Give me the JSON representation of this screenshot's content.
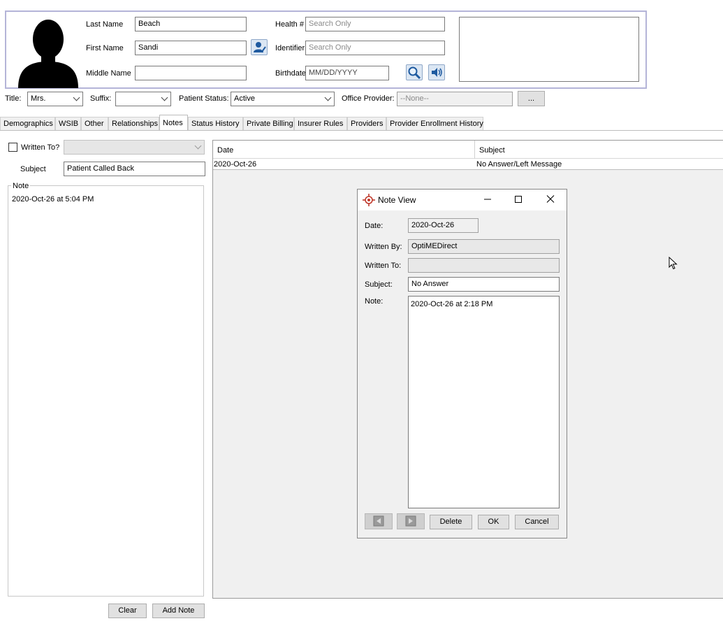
{
  "patient": {
    "last_name_label": "Last Name",
    "last_name": "Beach",
    "first_name_label": "First Name",
    "first_name": "Sandi",
    "middle_name_label": "Middle Name",
    "middle_name": "",
    "health_label": "Health #",
    "health_placeholder": "Search Only",
    "identifier_label": "Identifier",
    "identifier_placeholder": "Search Only",
    "birthdate_label": "Birthdate",
    "birthdate_placeholder": "MM/DD/YYYY"
  },
  "info_row": {
    "title_label": "Title:",
    "title_value": "Mrs.",
    "suffix_label": "Suffix:",
    "suffix_value": "",
    "status_label": "Patient Status:",
    "status_value": "Active",
    "office_provider_label": "Office Provider:",
    "office_provider_placeholder": "--None--",
    "more_button": "..."
  },
  "tabs": [
    {
      "label": "Demographics"
    },
    {
      "label": "WSIB"
    },
    {
      "label": "Other"
    },
    {
      "label": "Relationships"
    },
    {
      "label": "Notes"
    },
    {
      "label": "Status History"
    },
    {
      "label": "Private Billing"
    },
    {
      "label": "Insurer Rules"
    },
    {
      "label": "Providers"
    },
    {
      "label": "Provider Enrollment History"
    }
  ],
  "note_editor": {
    "written_to_label": "Written To?",
    "subject_label": "Subject",
    "subject_value": "Patient Called Back",
    "note_group_label": "Note",
    "note_text": "2020-Oct-26 at 5:04 PM",
    "clear_button": "Clear",
    "add_note_button": "Add Note"
  },
  "notes_table": {
    "columns": [
      "Date",
      "Subject"
    ],
    "rows": [
      {
        "date": "2020-Oct-26",
        "subject": "No Answer/Left Message"
      }
    ]
  },
  "dialog": {
    "title": "Note View",
    "date_label": "Date:",
    "date_value": "2020-Oct-26",
    "written_by_label": "Written By:",
    "written_by_value": "OptiMEDirect",
    "written_to_label": "Written To:",
    "written_to_value": "",
    "subject_label": "Subject:",
    "subject_value": "No Answer",
    "note_label": "Note:",
    "note_value": "2020-Oct-26 at 2:18 PM",
    "delete_button": "Delete",
    "ok_button": "OK",
    "cancel_button": "Cancel"
  },
  "colors": {
    "header_border": "#b4b4d8",
    "icon_blue": "#1e5aa0",
    "dialog_icon": "#c0392b",
    "panel_bg": "#f0f0f0"
  }
}
